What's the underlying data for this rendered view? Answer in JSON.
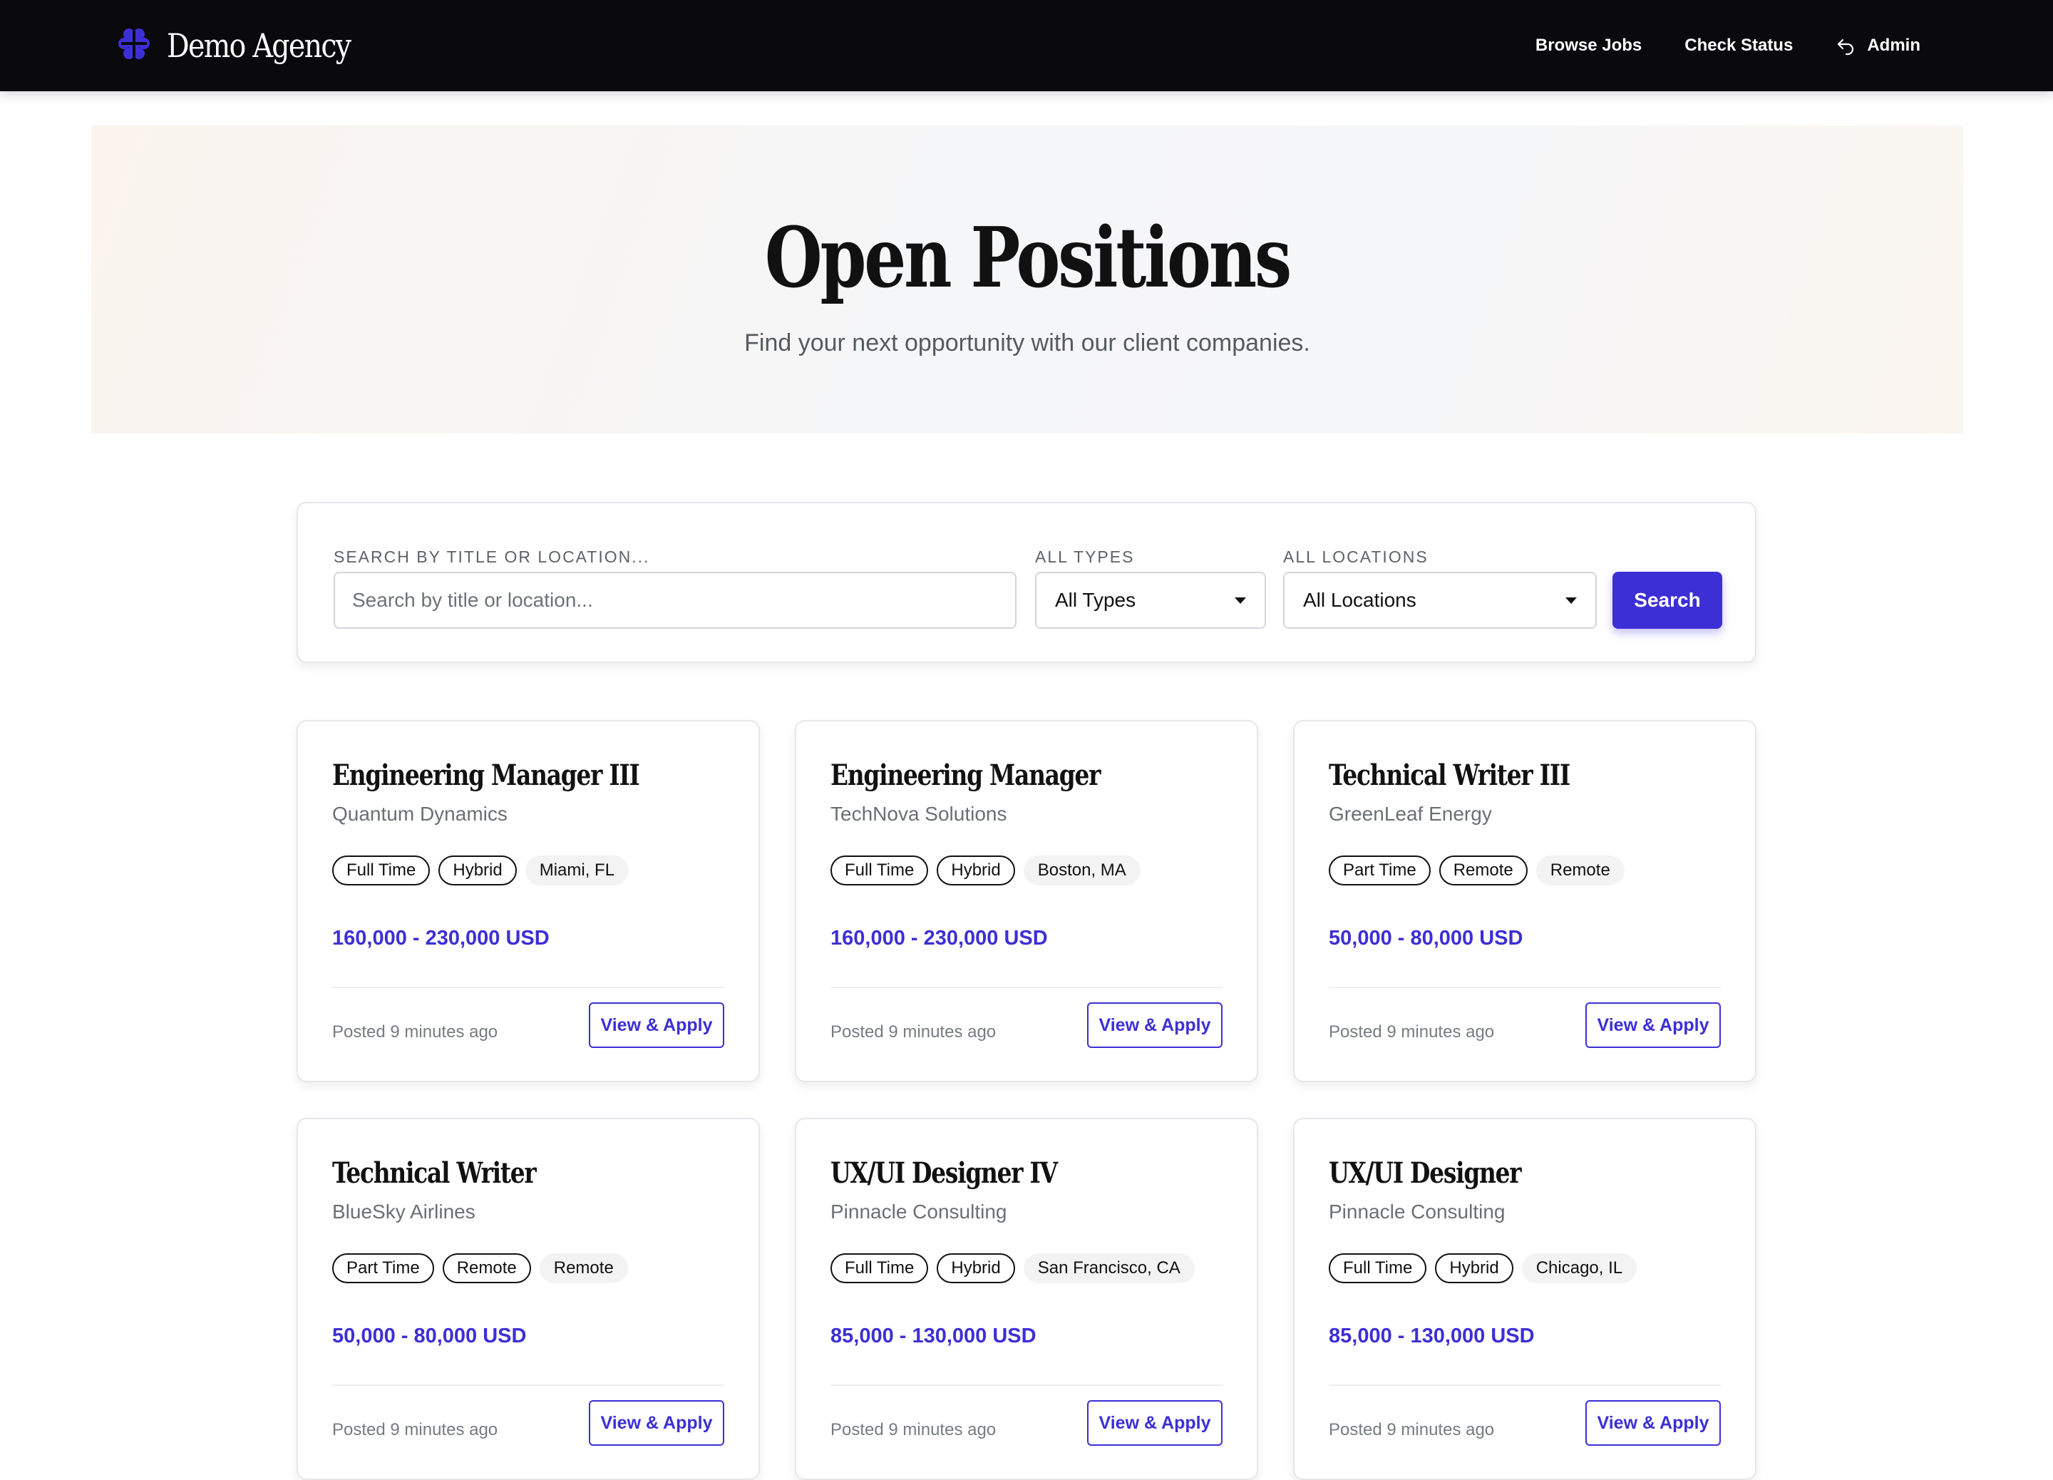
{
  "brand": {
    "name": "Demo Agency",
    "icon": "flower-logo-icon",
    "icon_color": "#3d2fd6"
  },
  "nav": {
    "browse_jobs": "Browse Jobs",
    "check_status": "Check Status",
    "admin": "Admin",
    "admin_icon": "back-arrow-icon"
  },
  "hero": {
    "title": "Open Positions",
    "subtitle": "Find your next opportunity with our client companies."
  },
  "search": {
    "query_label": "SEARCH BY TITLE OR LOCATION...",
    "query_placeholder": "Search by title or location...",
    "query_value": "",
    "type_label": "ALL TYPES",
    "type_selected": "All Types",
    "location_label": "ALL LOCATIONS",
    "location_selected": "All Locations",
    "button": "Search"
  },
  "colors": {
    "accent": "#3d2fd6",
    "nav_bg": "#0a0a0c"
  },
  "jobs": [
    {
      "title": "Engineering Manager III",
      "company": "Quantum Dynamics",
      "type": "Full Time",
      "mode": "Hybrid",
      "location": "Miami, FL",
      "salary": "160,000 - 230,000 USD",
      "posted": "Posted 9 minutes ago",
      "action": "View & Apply"
    },
    {
      "title": "Engineering Manager",
      "company": "TechNova Solutions",
      "type": "Full Time",
      "mode": "Hybrid",
      "location": "Boston, MA",
      "salary": "160,000 - 230,000 USD",
      "posted": "Posted 9 minutes ago",
      "action": "View & Apply"
    },
    {
      "title": "Technical Writer III",
      "company": "GreenLeaf Energy",
      "type": "Part Time",
      "mode": "Remote",
      "location": "Remote",
      "salary": "50,000 - 80,000 USD",
      "posted": "Posted 9 minutes ago",
      "action": "View & Apply"
    },
    {
      "title": "Technical Writer",
      "company": "BlueSky Airlines",
      "type": "Part Time",
      "mode": "Remote",
      "location": "Remote",
      "salary": "50,000 - 80,000 USD",
      "posted": "Posted 9 minutes ago",
      "action": "View & Apply"
    },
    {
      "title": "UX/UI Designer IV",
      "company": "Pinnacle Consulting",
      "type": "Full Time",
      "mode": "Hybrid",
      "location": "San Francisco, CA",
      "salary": "85,000 - 130,000 USD",
      "posted": "Posted 9 minutes ago",
      "action": "View & Apply"
    },
    {
      "title": "UX/UI Designer",
      "company": "Pinnacle Consulting",
      "type": "Full Time",
      "mode": "Hybrid",
      "location": "Chicago, IL",
      "salary": "85,000 - 130,000 USD",
      "posted": "Posted 9 minutes ago",
      "action": "View & Apply"
    }
  ]
}
